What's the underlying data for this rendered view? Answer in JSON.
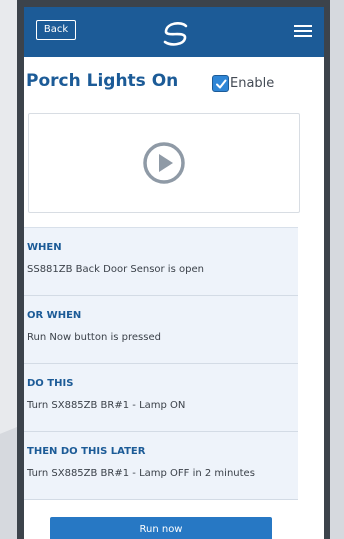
{
  "topbar": {
    "back_label": "Back",
    "logo_icon": "s-logo-icon",
    "menu_icon": "hamburger-menu-icon",
    "bg_color": "#1c5b97"
  },
  "header": {
    "title": "Porch Lights On",
    "enable_label": "Enable",
    "enable_checked": true
  },
  "video": {
    "icon": "play-circle-icon"
  },
  "steps": [
    {
      "heading": "WHEN",
      "text": "SS881ZB Back Door Sensor is open"
    },
    {
      "heading": "OR WHEN",
      "text": "Run Now button is pressed"
    },
    {
      "heading": "DO THIS",
      "text": "Turn SX885ZB BR#1 - Lamp ON"
    },
    {
      "heading": "THEN DO THIS LATER",
      "text": "Turn SX885ZB BR#1 - Lamp OFF in 2 minutes"
    }
  ],
  "run_button": {
    "label": "Run now",
    "color": "#2778c4"
  }
}
